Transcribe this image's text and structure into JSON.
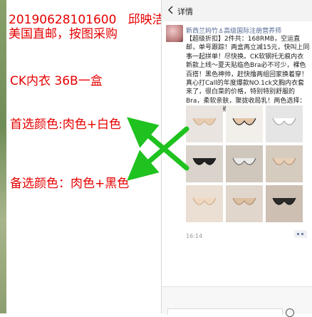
{
  "annotations": {
    "order_line": "20190628101600   邱映洁",
    "shipping_line": "美国直邮，按图采购",
    "product_line": "CK内衣 36B一盒",
    "first_choice": "首选颜色:肉色+白色",
    "second_choice": "备选颜色：肉色+黑色"
  },
  "colors": {
    "annotation_text": "#e60000",
    "arrow": "#1fc21f",
    "link_name": "#576b95"
  },
  "moments": {
    "header_title": "详情",
    "author": "新西兰妈竹⚓高级国际注册营养师",
    "post_text": "【超级折扣】2件共：168RMB，空运直邮，单号跟踪！两盒再立减15元，快叫上同事一起拼单！尽快换。CK软钢托无痕内衣新款上线～夏天贴临色Bra必不可少，裸色百搭！黑色神帅，赶快撸两组回家换着穿！真心打Call的年度爆款NO.1ck文胸内衣套来了，很白菜的价格，特别特别舒服的Bra，柔软亲肤，聚拢收局乳！两色选择：黑+裸，白+裸！",
    "time": "16:14"
  }
}
